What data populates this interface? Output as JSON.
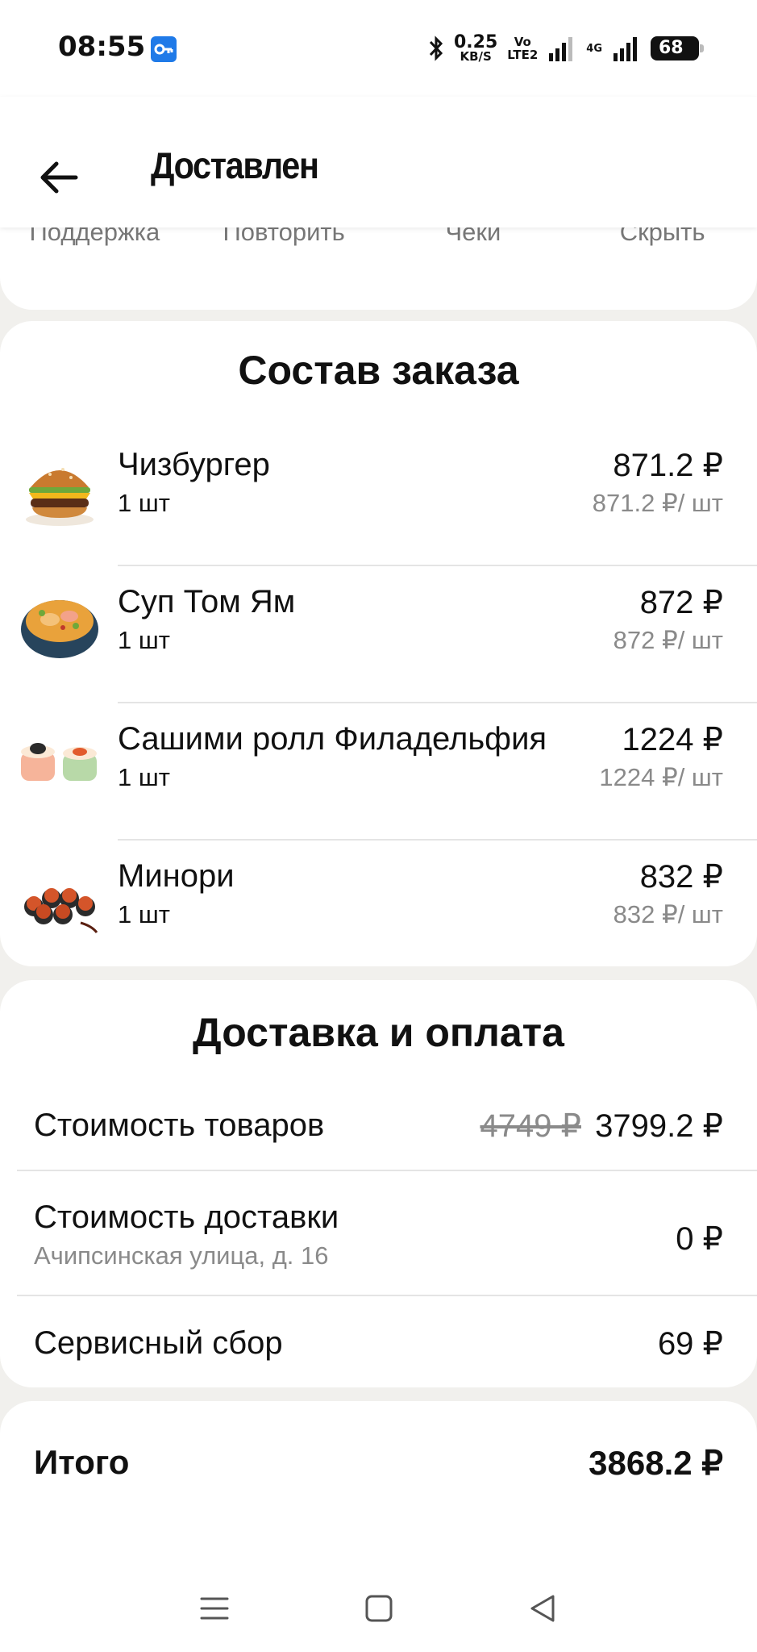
{
  "status_bar": {
    "time": "08:55",
    "net_speed_value": "0.25",
    "net_speed_unit": "KB/S",
    "volte_top": "Vo",
    "volte_bottom": "LTE2",
    "network_type": "4G",
    "battery": "68"
  },
  "header": {
    "title": "Доставлен"
  },
  "actions": [
    {
      "label": "Поддержка"
    },
    {
      "label": "Повторить"
    },
    {
      "label": "Чеки"
    },
    {
      "label": "Скрыть"
    }
  ],
  "order": {
    "title": "Состав заказа",
    "items": [
      {
        "name": "Чизбургер",
        "qty": "1 шт",
        "price": "871.2 ₽",
        "unit_price": "871.2 ₽/ шт",
        "icon": "cheeseburger"
      },
      {
        "name": "Суп Том Ям",
        "qty": "1 шт",
        "price": "872 ₽",
        "unit_price": "872 ₽/ шт",
        "icon": "tom-yum-soup"
      },
      {
        "name": "Сашими ролл Филадельфия",
        "qty": "1 шт",
        "price": "1224 ₽",
        "unit_price": "1224 ₽/ шт",
        "icon": "sashimi-roll"
      },
      {
        "name": "Минори",
        "qty": "1 шт",
        "price": "832 ₽",
        "unit_price": "832 ₽/ шт",
        "icon": "minori-rolls"
      }
    ]
  },
  "delivery": {
    "title": "Доставка и оплата",
    "goods_label": "Стоимость товаров",
    "goods_old_price": "4749 ₽",
    "goods_price": "3799.2 ₽",
    "delivery_label": "Стоимость доставки",
    "delivery_address": "Ачипсинская улица, д. 16",
    "delivery_price": "0 ₽",
    "service_label": "Сервисный сбор",
    "service_price": "69 ₽"
  },
  "total": {
    "label": "Итого",
    "value": "3868.2 ₽"
  },
  "colors": {
    "background": "#f1f0ed",
    "card": "#ffffff",
    "muted_text": "#8a8a8a",
    "vpn_badge": "#1f7ae8"
  }
}
